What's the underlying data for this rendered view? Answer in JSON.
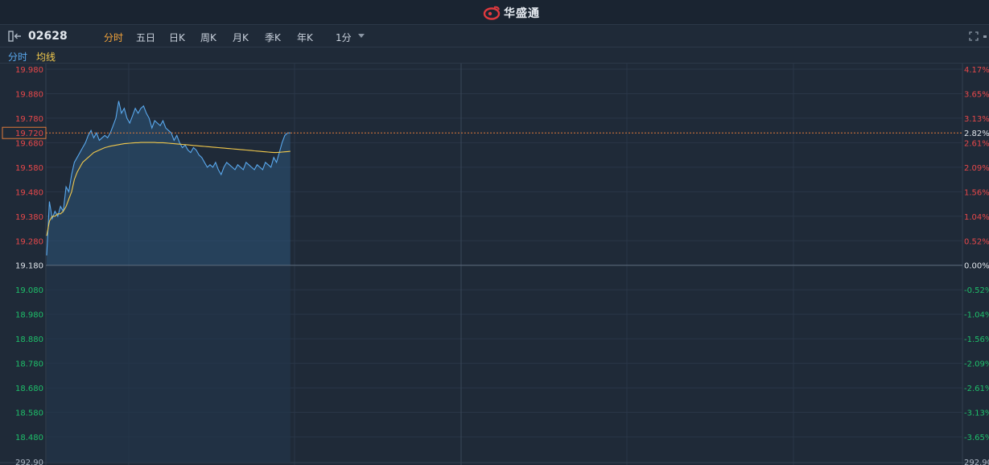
{
  "app": {
    "brand_name": "华盛通",
    "brand_color": "#e0393e"
  },
  "toolbar": {
    "back_icon": "exit-arrow-icon",
    "stock_code": "02628",
    "tabs": [
      {
        "label": "分时",
        "active": true
      },
      {
        "label": "五日",
        "active": false
      },
      {
        "label": "日K",
        "active": false
      },
      {
        "label": "周K",
        "active": false
      },
      {
        "label": "月K",
        "active": false
      },
      {
        "label": "季K",
        "active": false
      },
      {
        "label": "年K",
        "active": false
      }
    ],
    "interval_label": "1分",
    "expand_icon": "fullscreen-icon"
  },
  "legend": {
    "price_label": "分时",
    "avg_label": "均线",
    "price_color": "#5aa9ee",
    "avg_color": "#f2c94c"
  },
  "chart_data": {
    "type": "line",
    "series": [
      {
        "name": "分时",
        "color": "#5aa9ee",
        "values": [
          19.22,
          19.44,
          19.37,
          19.4,
          19.38,
          19.42,
          19.4,
          19.5,
          19.48,
          19.55,
          19.6,
          19.62,
          19.64,
          19.66,
          19.68,
          19.71,
          19.73,
          19.7,
          19.72,
          19.69,
          19.7,
          19.71,
          19.7,
          19.72,
          19.75,
          19.78,
          19.85,
          19.8,
          19.82,
          19.78,
          19.76,
          19.79,
          19.82,
          19.8,
          19.82,
          19.83,
          19.8,
          19.78,
          19.74,
          19.77,
          19.76,
          19.75,
          19.77,
          19.74,
          19.73,
          19.72,
          19.69,
          19.71,
          19.68,
          19.66,
          19.67,
          19.65,
          19.64,
          19.66,
          19.65,
          19.63,
          19.62,
          19.6,
          19.58,
          19.59,
          19.58,
          19.6,
          19.57,
          19.55,
          19.58,
          19.6,
          19.59,
          19.58,
          19.57,
          19.59,
          19.58,
          19.57,
          19.6,
          19.59,
          19.58,
          19.57,
          19.59,
          19.58,
          19.57,
          19.6,
          19.59,
          19.58,
          19.62,
          19.6,
          19.64,
          19.68,
          19.71,
          19.72,
          19.72
        ]
      },
      {
        "name": "均线",
        "color": "#f2c94c",
        "values": [
          19.3,
          19.36,
          19.38,
          19.38,
          19.39,
          19.39,
          19.4,
          19.42,
          19.45,
          19.48,
          19.53,
          19.56,
          19.58,
          19.6,
          19.61,
          19.62,
          19.63,
          19.64,
          19.645,
          19.65,
          19.655,
          19.66,
          19.663,
          19.666,
          19.668,
          19.67,
          19.672,
          19.674,
          19.676,
          19.677,
          19.678,
          19.679,
          19.68,
          19.68,
          19.681,
          19.681,
          19.681,
          19.681,
          19.681,
          19.681,
          19.68,
          19.68,
          19.68,
          19.679,
          19.678,
          19.677,
          19.676,
          19.675,
          19.674,
          19.673,
          19.672,
          19.671,
          19.67,
          19.669,
          19.668,
          19.667,
          19.666,
          19.665,
          19.664,
          19.663,
          19.662,
          19.661,
          19.66,
          19.659,
          19.658,
          19.657,
          19.656,
          19.655,
          19.654,
          19.653,
          19.652,
          19.651,
          19.65,
          19.649,
          19.648,
          19.647,
          19.646,
          19.645,
          19.644,
          19.643,
          19.642,
          19.641,
          19.64,
          19.64,
          19.641,
          19.642,
          19.643,
          19.644,
          19.645
        ]
      }
    ],
    "prev_close": 19.18,
    "current_price": "19.720",
    "current_change": "2.82%",
    "y_ticks_left": [
      "19.980",
      "19.880",
      "19.780",
      "19.680",
      "19.580",
      "19.480",
      "19.380",
      "19.280",
      "19.180",
      "19.080",
      "18.980",
      "18.880",
      "18.780",
      "18.680",
      "18.580",
      "18.480"
    ],
    "y_ticks_right": [
      "4.17%",
      "3.65%",
      "3.13%",
      "2.61%",
      "2.09%",
      "1.56%",
      "1.04%",
      "0.52%",
      "0.00%",
      "-0.52%",
      "-1.04%",
      "-1.56%",
      "-2.09%",
      "-2.61%",
      "-3.13%",
      "-3.65%"
    ],
    "bottom_label_left": "292.90",
    "bottom_label_right": "292.90",
    "ylim": [
      18.46,
      20.0
    ],
    "up_color": "#e8484a",
    "down_color": "#1fbf6a",
    "flat_color": "#dfe4ea",
    "grid": true
  }
}
